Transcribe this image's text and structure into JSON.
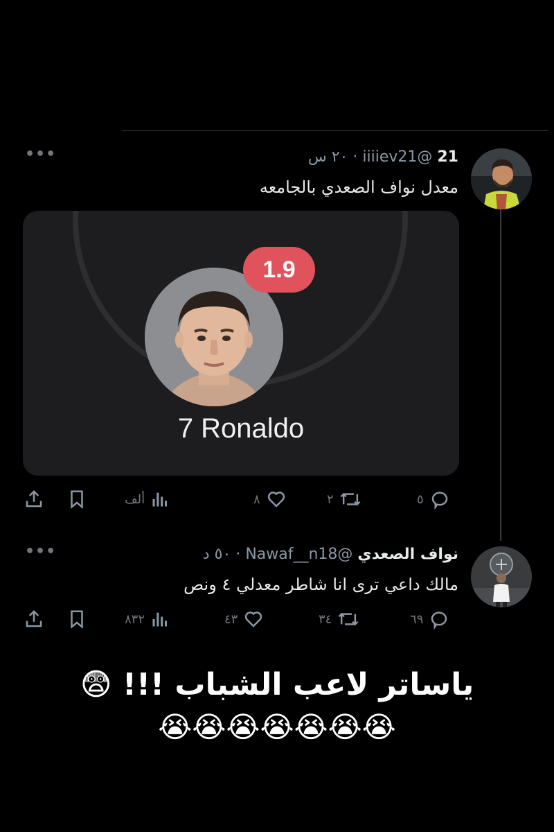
{
  "tweet1": {
    "name": "21",
    "handle": "@iiiiev21",
    "separator": "·",
    "time": "٢٠ س",
    "text": "معدل نواف الصعدي بالجامعه",
    "more_icon": "more-icon",
    "media": {
      "rating": "1.9",
      "player": "7 Ronaldo"
    },
    "stats": {
      "replies": "٥",
      "retweets": "٢",
      "likes": "٨",
      "views": "ألف"
    }
  },
  "tweet2": {
    "name": "نواف الصعدي",
    "handle": "@Nawaf__n18",
    "separator": "·",
    "time": "٥٠ د",
    "text": "مالك داعي ترى انا شاطر معدلي ٤ ونص",
    "stats": {
      "replies": "٦٩",
      "retweets": "٣٤",
      "likes": "٤٣",
      "views": "٨٣٢"
    }
  },
  "caption": {
    "line1": "ياساتر لاعب الشباب !!! 😨",
    "line2": "😭😭😭😭😭😭😭"
  },
  "colors": {
    "background": "#000000",
    "text": "#e7e9ea",
    "muted": "#71767b",
    "rating_badge": "#e0525c",
    "card": "#1d1d1f"
  }
}
